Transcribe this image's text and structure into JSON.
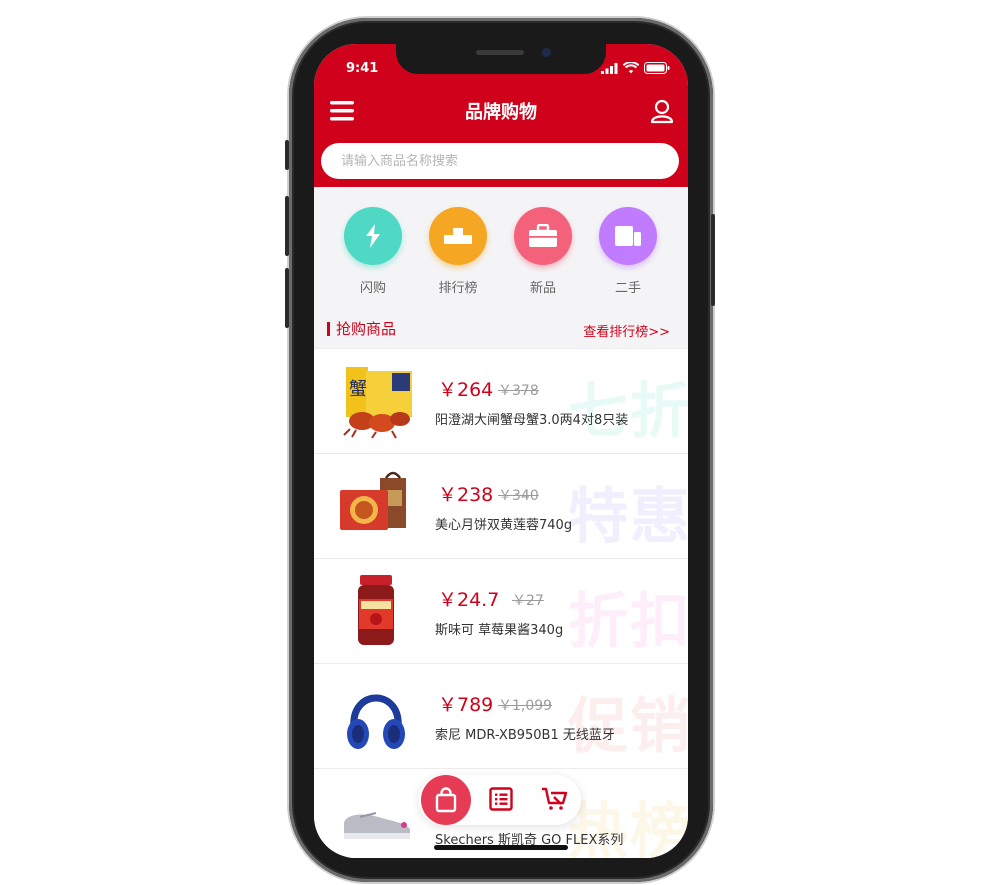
{
  "status": {
    "time": "9:41"
  },
  "header": {
    "title": "品牌购物"
  },
  "search": {
    "placeholder": "请输入商品名称搜索"
  },
  "categories": [
    {
      "label": "闪购",
      "icon": "flash-icon",
      "color": "#4fd9c4"
    },
    {
      "label": "排行榜",
      "icon": "podium-icon",
      "color": "#f5a623"
    },
    {
      "label": "新品",
      "icon": "briefcase-icon",
      "color": "#f4617a"
    },
    {
      "label": "二手",
      "icon": "device-icon",
      "color": "#c07bff"
    }
  ],
  "section": {
    "title": "抢购商品",
    "more": "查看排行榜>>"
  },
  "products": [
    {
      "price": "￥264",
      "old_price": "￥378",
      "name": "阳澄湖大闸蟹母蟹3.0两4对8只装",
      "promo": "七折",
      "promo_color": "#e8faf6",
      "thumb_icon": "crab-box-icon"
    },
    {
      "price": "￥238",
      "old_price": "￥340",
      "name": "美心月饼双黄莲蓉740g",
      "promo": "特惠",
      "promo_color": "#f1eefe",
      "thumb_icon": "mooncake-box-icon"
    },
    {
      "price": "￥24.7",
      "old_price": "￥27",
      "name": "斯味可 草莓果酱340g",
      "promo": "折扣",
      "promo_color": "#fdeefa",
      "thumb_icon": "jam-jar-icon"
    },
    {
      "price": "￥789",
      "old_price": "￥1,099",
      "name": "索尼 MDR-XB950B1 无线蓝牙",
      "promo": "促销",
      "promo_color": "#fdeeee",
      "thumb_icon": "headphones-icon"
    },
    {
      "price": "",
      "old_price": "",
      "name": "Skechers 斯凯奇 GO FLEX系列",
      "promo": "热榜",
      "promo_color": "#fdf7e8",
      "thumb_icon": "shoe-icon"
    }
  ],
  "tabbar": {
    "items": [
      "bag-icon",
      "list-icon",
      "cart-icon"
    ]
  }
}
